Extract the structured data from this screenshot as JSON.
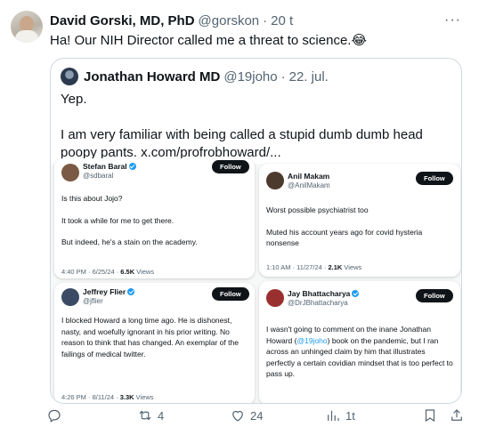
{
  "tweet": {
    "author_name": "David Gorski, MD, PhD",
    "author_handle": "@gorskon",
    "separator": "·",
    "time": "20 t",
    "more_icon": "more-horizontal-icon",
    "text": "Ha! Our NIH Director called me a threat to science.",
    "emoji": "😂"
  },
  "quote": {
    "author_name": "Jonathan Howard MD",
    "author_handle": "@19joho",
    "separator": "·",
    "time": "22. jul.",
    "line1": "Yep.",
    "line2": "I am very familiar with being called a stupid dumb dumb head poopy pants.",
    "link": "x.com/profrobhoward/..."
  },
  "media": {
    "cards": [
      {
        "name": "Stefan Baral",
        "handle": "@sdbaral",
        "follow": "Follow",
        "body": [
          "Is this about Jojo?",
          "It took a while for me to get there.",
          "But indeed, he's a stain on the academy."
        ],
        "meta_time": "4:40 PM · 6/25/24 · ",
        "meta_views": "6.5K",
        "meta_suffix": " Views"
      },
      {
        "name": "Jeffrey Flier",
        "handle": "@jflier",
        "follow": "Follow",
        "body": [
          "I blocked Howard a long time ago. He is dishonest, nasty, and woefully ignorant in his prior writing. No reason to think that has changed. An exemplar of the failings of medical twitter."
        ],
        "meta_time": "4:26 PM · 8/11/24 · ",
        "meta_views": "3.3K",
        "meta_suffix": " Views"
      },
      {
        "name": "Anil Makam",
        "handle": "@AnilMakam",
        "follow": "Follow",
        "body": [
          "Worst possible psychiatrist too",
          "Muted his account years ago for covid hysteria nonsense"
        ],
        "meta_time": "1:10 AM · 11/27/24 · ",
        "meta_views": "2.1K",
        "meta_suffix": " Views"
      },
      {
        "name": "Jay Bhattacharya",
        "handle": "@DrJBhattacharya",
        "follow": "Follow",
        "body_pre": "I wasn't going to comment on the inane Jonathan Howard (",
        "body_mention": "@19joho",
        "body_post": ") book on the pandemic, but I ran across an unhinged claim by him that illustrates perfectly a certain covidian mindset that is too perfect to pass up."
      }
    ]
  },
  "actions": {
    "reply_icon": "reply-icon",
    "repost_icon": "repost-icon",
    "repost_count": "4",
    "like_icon": "heart-icon",
    "like_count": "24",
    "views_icon": "views-icon",
    "views_count": "1t",
    "bookmark_icon": "bookmark-icon",
    "share_icon": "share-icon"
  },
  "colors": {
    "accent": "#1d9bf0",
    "text": "#0f1419",
    "muted": "#536471",
    "border": "#cfd9de"
  }
}
